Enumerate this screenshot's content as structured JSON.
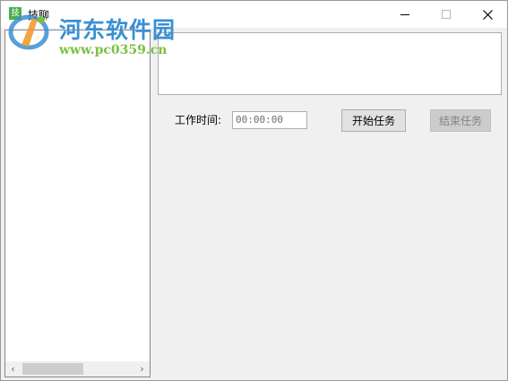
{
  "window": {
    "title": "技聊",
    "app_icon_glyph": "技"
  },
  "watermark": {
    "brand": "河东软件园",
    "url": "www.pc0359.cn"
  },
  "controls": {
    "minimize": "minimize-icon",
    "maximize": "maximize-icon",
    "close": "close-icon"
  },
  "tree": {
    "scroll_left": "‹",
    "scroll_right": "›"
  },
  "form": {
    "work_time_label": "工作时间:",
    "work_time_value": "00:00:00",
    "start_button": "开始任务",
    "stop_button": "结束任务"
  },
  "colors": {
    "brand_blue": "#3a8fd4",
    "brand_green": "#7ac143",
    "icon_green": "#4caf50"
  }
}
